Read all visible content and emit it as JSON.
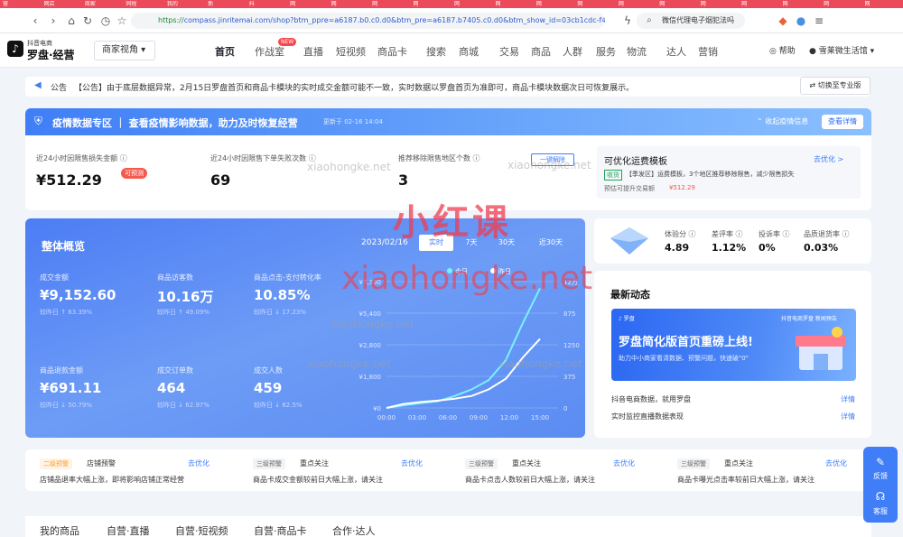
{
  "browser": {
    "tab_labels": [
      "营",
      "网店",
      "商家",
      "同程",
      "我的",
      "新",
      "抖",
      "网",
      "网",
      "网",
      "网",
      "网",
      "网",
      "网",
      "网",
      "网",
      "网",
      "网",
      "网",
      "网",
      "网",
      "网"
    ],
    "url_prefix": "https://",
    "url": "compass.jinritemai.com/shop?btm_ppre=a6187.b0.c0.d0&btm_pre=a6187.b7405.c0.d0&btm_show_id=03cb1cdc-f4a",
    "search_text": "微信代理电子烟犯法吗"
  },
  "app": {
    "logo_top": "抖音电商",
    "logo_main": "罗盘·经营",
    "view_select": "商家视角 ▾",
    "nav": [
      "首页",
      "作战室",
      "直播",
      "短视频",
      "商品卡",
      "搜索",
      "商城",
      "交易",
      "商品",
      "人群",
      "服务",
      "物流",
      "达人",
      "营销"
    ],
    "new_badge": "NEW",
    "help": "帮助",
    "user": "雪莱微生活馆 ▾"
  },
  "notice": {
    "label": "公告",
    "text": "【公告】由于底层数据异常，2月15日罗盘首页和商品卡模块的实时成交金额可能不一致，实时数据以罗盘首页为准即可，商品卡模块数据次日可恢复展示。",
    "switch_label": "⇄ 切换至专业版"
  },
  "epidemic": {
    "title": "疫情数据专区 ｜ 查看疫情影响数据，助力及时恢复经营",
    "updated": "更新于 02-16 14:04",
    "collapse": "收起疫情信息",
    "detail": "查看详情",
    "metrics": [
      {
        "label": "近24小时因限售损失金额 ⓘ",
        "value": "¥512.29"
      },
      {
        "label": "近24小时因限售下单失败次数 ⓘ",
        "value": "69"
      },
      {
        "label": "推荐移除限售地区个数 ⓘ",
        "value": "3"
      }
    ],
    "preview_tag": "可预测",
    "onekey": "一键解除",
    "template_title": "可优化运费模板",
    "template_link": "去优化 >",
    "template_tag": "收货",
    "template_desc": "【季发区】运费模板，3个地区推荐移除限售，减少限售损失",
    "template_gain_label": "预估可提升交易额",
    "template_gain_value": "¥512.29"
  },
  "overview": {
    "title": "整体概览",
    "date": "2023/02/16",
    "tabs": [
      "实时",
      "7天",
      "30天",
      "近30天"
    ],
    "metrics": [
      {
        "label": "成交金额",
        "value": "¥9,152.60",
        "cmp": "较昨日 ↑ 63.39%"
      },
      {
        "label": "商品访客数",
        "value": "10.16万",
        "cmp": "较昨日 ↑ 49.09%"
      },
      {
        "label": "商品点击-支付转化率",
        "value": "10.85%",
        "cmp": "较昨日 ↓ 17.23%"
      },
      {
        "label": "商品退款金额",
        "value": "¥691.11",
        "cmp": "较昨日 ↓ 50.79%"
      },
      {
        "label": "成交订单数",
        "value": "464",
        "cmp": "较昨日 ↓ 62.97%"
      },
      {
        "label": "成交人数",
        "value": "459",
        "cmp": "较昨日 ↓ 62.5%"
      }
    ],
    "legend": [
      "今日",
      "昨日"
    ]
  },
  "chart_data": {
    "type": "line",
    "x": [
      "00:00",
      "03:00",
      "06:00",
      "09:00",
      "12:00",
      "15:00"
    ],
    "y_left_ticks": [
      "¥0",
      "¥1,800",
      "¥2,800",
      "¥5,400",
      "¥7,300"
    ],
    "y_right_ticks": [
      "0",
      "375",
      "1250",
      "875",
      "12万"
    ],
    "series": [
      {
        "name": "今日",
        "color": "#7cf0ff",
        "values": [
          0,
          200,
          350,
          500,
          900,
          1400,
          2100,
          3600,
          6400,
          9000
        ]
      },
      {
        "name": "昨日",
        "color": "#ffffff",
        "values": [
          0,
          300,
          450,
          550,
          700,
          900,
          1400,
          2200,
          3800,
          5200
        ]
      }
    ]
  },
  "score": {
    "items": [
      {
        "label": "体验分 ⓘ",
        "value": "4.89"
      },
      {
        "label": "差评率 ⓘ",
        "value": "1.12%"
      },
      {
        "label": "投诉率 ⓘ",
        "value": "0%"
      },
      {
        "label": "品质退货率 ⓘ",
        "value": "0.03%"
      }
    ]
  },
  "news": {
    "title": "最新动态",
    "banner_top": "抖音电商罗盘 新闻预告",
    "banner_title": "罗盘简化版首页重磅上线!",
    "banner_sub": "助力中小商家看清数据、预警问题，快速破\"0\"",
    "rows": [
      {
        "text": "抖音电商数据，就用罗盘",
        "link": "详情"
      },
      {
        "text": "实时监控直播数据表现",
        "link": "详情"
      }
    ]
  },
  "alerts": [
    {
      "tag": "二级预警",
      "tag_color": "#f7a23b",
      "tag2": "店铺预警",
      "opt": "去优化",
      "desc": "店铺品退率大幅上涨，即将影响店铺正常经营"
    },
    {
      "tag": "三级预警",
      "tag_color": "#999999",
      "tag2": "重点关注",
      "opt": "去优化",
      "desc": "商品卡成交金额较前日大幅上涨，请关注"
    },
    {
      "tag": "三级预警",
      "tag_color": "#999999",
      "tag2": "重点关注",
      "opt": "去优化",
      "desc": "商品卡点击人数较前日大幅上涨，请关注"
    },
    {
      "tag": "三级预警",
      "tag_color": "#999999",
      "tag2": "重点关注",
      "opt": "去优化",
      "desc": "商品卡曝光点击率较前日大幅上涨，请关注"
    }
  ],
  "bottom_tabs": [
    "我的商品",
    "自营·直播",
    "自营·短视频",
    "自营·商品卡",
    "合作·达人"
  ],
  "float": {
    "feedback": "反馈",
    "service": "客服"
  },
  "watermarks": {
    "big": "小红课",
    "url": "xiaohongke.net",
    "small": "xiaohongke.net"
  }
}
